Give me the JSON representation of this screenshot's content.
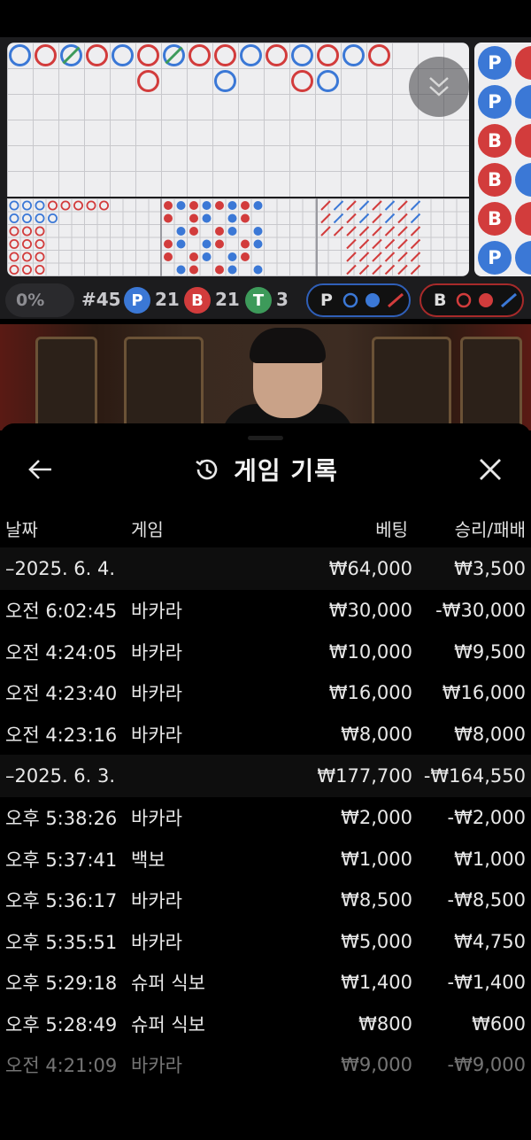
{
  "scoreboard": {
    "bigroad": [
      {
        "c": "P"
      },
      {
        "c": "B"
      },
      {
        "c": "P",
        "tie": true
      },
      {
        "c": "B"
      },
      {
        "c": "P"
      },
      {
        "c": "B"
      },
      {
        "c": "P",
        "tie": true
      },
      {
        "c": "B"
      },
      {
        "c": "B"
      },
      {
        "c": "P"
      },
      {
        "c": "B"
      },
      {
        "c": "P"
      },
      {
        "c": "B"
      },
      {
        "c": "P"
      },
      {
        "c": "B"
      }
    ],
    "bigroad_row2": [
      "B",
      "P",
      "B"
    ],
    "beads": [
      "P",
      "P",
      "B",
      "B",
      "B",
      "P"
    ],
    "shoe_percent": "0%",
    "round_label": "#45",
    "player_count": "21",
    "banker_count": "21",
    "tie_count": "3",
    "player_letter": "P",
    "banker_letter": "B",
    "tie_letter": "T",
    "predict_player_label": "P",
    "predict_banker_label": "B",
    "colors": {
      "player": "#3b78d6",
      "banker": "#d23c3c",
      "tie": "#3d9a5a"
    }
  },
  "history": {
    "title": "게임 기록",
    "columns": {
      "date": "날짜",
      "game": "게임",
      "bet": "베팅",
      "result": "승리/패배"
    },
    "rows": [
      {
        "type": "group",
        "date": "–2025. 6. 4.",
        "game": "",
        "bet": "₩64,000",
        "result": "₩3,500"
      },
      {
        "type": "item",
        "date": "오전 6:02:45",
        "game": "바카라",
        "bet": "₩30,000",
        "result": "-₩30,000"
      },
      {
        "type": "item",
        "date": "오전 4:24:05",
        "game": "바카라",
        "bet": "₩10,000",
        "result": "₩9,500"
      },
      {
        "type": "item",
        "date": "오전 4:23:40",
        "game": "바카라",
        "bet": "₩16,000",
        "result": "₩16,000"
      },
      {
        "type": "item",
        "date": "오전 4:23:16",
        "game": "바카라",
        "bet": "₩8,000",
        "result": "₩8,000"
      },
      {
        "type": "group",
        "date": "–2025. 6. 3.",
        "game": "",
        "bet": "₩177,700",
        "result": "-₩164,550"
      },
      {
        "type": "item",
        "date": "오후 5:38:26",
        "game": "바카라",
        "bet": "₩2,000",
        "result": "-₩2,000"
      },
      {
        "type": "item",
        "date": "오후 5:37:41",
        "game": "백보",
        "bet": "₩1,000",
        "result": "₩1,000"
      },
      {
        "type": "item",
        "date": "오후 5:36:17",
        "game": "바카라",
        "bet": "₩8,500",
        "result": "-₩8,500"
      },
      {
        "type": "item",
        "date": "오후 5:35:51",
        "game": "바카라",
        "bet": "₩5,000",
        "result": "₩4,750"
      },
      {
        "type": "item",
        "date": "오후 5:29:18",
        "game": "슈퍼 식보",
        "bet": "₩1,400",
        "result": "-₩1,400"
      },
      {
        "type": "item",
        "date": "오후 5:28:49",
        "game": "슈퍼 식보",
        "bet": "₩800",
        "result": "₩600"
      },
      {
        "type": "item",
        "date": "오전 4:21:09",
        "game": "바카라",
        "bet": "₩9,000",
        "result": "-₩9,000",
        "fade": 1
      }
    ]
  }
}
